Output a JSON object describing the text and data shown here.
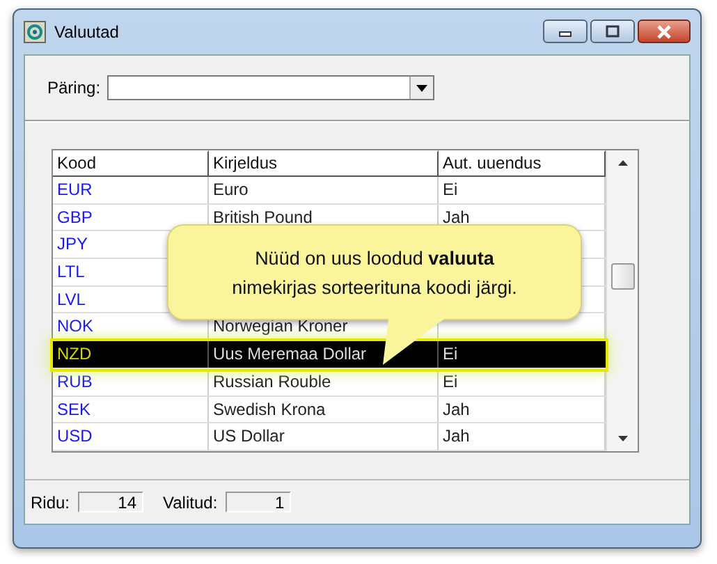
{
  "window": {
    "title": "Valuutad"
  },
  "query": {
    "label": "Päring:"
  },
  "table": {
    "columns": [
      "Kood",
      "Kirjeldus",
      "Aut. uuendus"
    ],
    "rows": [
      {
        "code": "EUR",
        "description": "Euro",
        "auto_update": "Ei",
        "selected": false
      },
      {
        "code": "GBP",
        "description": "British Pound",
        "auto_update": "Jah",
        "selected": false
      },
      {
        "code": "JPY",
        "selected": false
      },
      {
        "code": "LTL",
        "selected": false
      },
      {
        "code": "LVL",
        "selected": false
      },
      {
        "code": "NOK",
        "description": "Norwegian Kroner",
        "selected": false
      },
      {
        "code": "NZD",
        "description": "Uus Meremaa Dollar",
        "auto_update": "Ei",
        "selected": true
      },
      {
        "code": "RUB",
        "description": "Russian Rouble",
        "auto_update": "Ei",
        "selected": false
      },
      {
        "code": "SEK",
        "description": "Swedish Krona",
        "auto_update": "Jah",
        "selected": false
      },
      {
        "code": "USD",
        "description": "US Dollar",
        "auto_update": "Jah",
        "selected": false
      }
    ]
  },
  "callout": {
    "text": "Nüüd on uus loodud **valuuta** nimekirjas sorteerituna koodi järgi."
  },
  "status_bar": {
    "rows_label": "Ridu:",
    "rows_value": "14",
    "selected_label": "Valitud:",
    "selected_value": "1"
  }
}
